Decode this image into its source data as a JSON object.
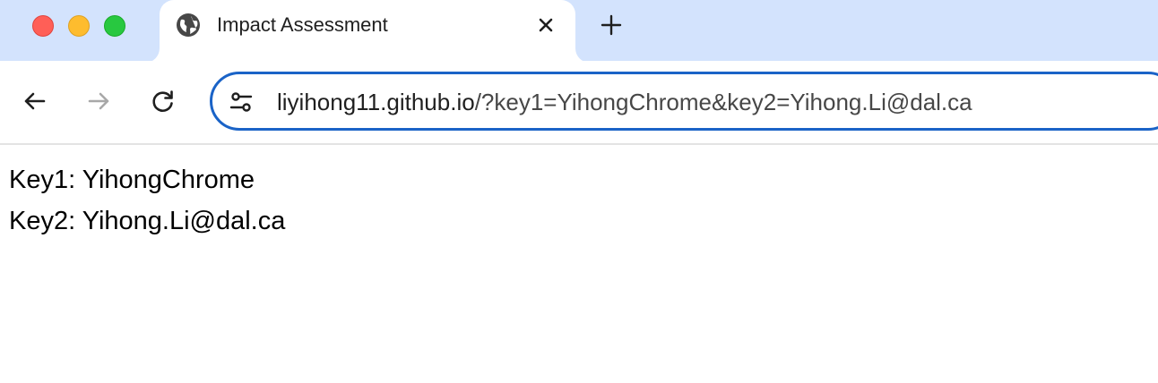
{
  "browser": {
    "tab": {
      "title": "Impact Assessment",
      "favicon": "globe-icon",
      "close_icon": "close-icon"
    },
    "new_tab_icon": "plus-icon",
    "toolbar": {
      "back_icon": "arrow-left-icon",
      "forward_icon": "arrow-right-icon",
      "reload_icon": "reload-icon",
      "site_info_icon": "tune-icon"
    },
    "address_bar": {
      "host": "liyihong11.github.io",
      "path": "/?key1=YihongChrome&key2=Yihong.Li@dal.ca"
    },
    "colors": {
      "tabstrip": "#d3e3fd",
      "focus_ring": "#1a63c7",
      "close": "#ff5f57",
      "minimize": "#febc2e",
      "zoom": "#28c840"
    }
  },
  "page": {
    "lines": [
      "Key1: YihongChrome",
      "Key2: Yihong.Li@dal.ca"
    ]
  }
}
